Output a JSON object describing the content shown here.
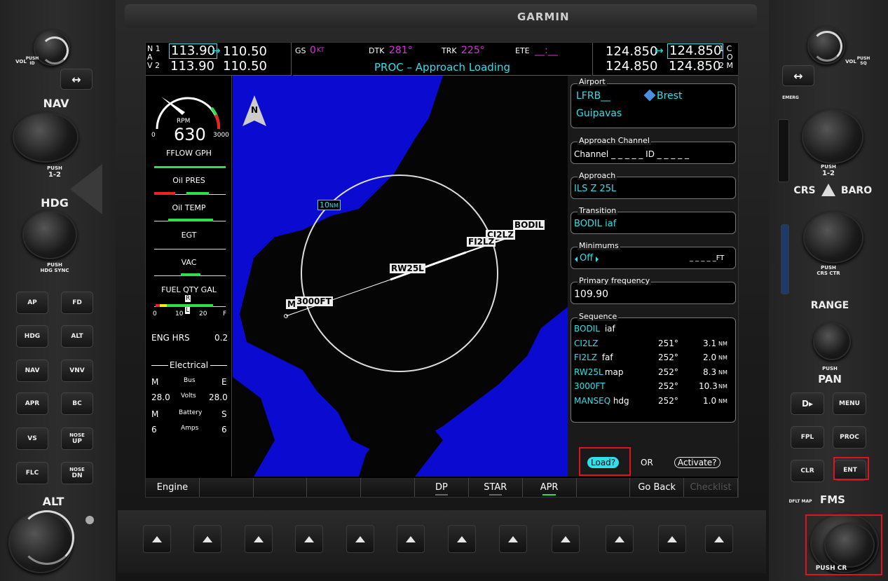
{
  "brand": "GARMIN",
  "left_panel": {
    "vol_label": "VOL",
    "vol_push": "PUSH ID",
    "swap_label": "↔",
    "nav_label": "NAV",
    "nav_push": "PUSH",
    "nav_push2": "1-2",
    "hdg_label": "HDG",
    "hdg_push": "PUSH",
    "hdg_push2": "HDG SYNC",
    "alt_label": "ALT",
    "buttons": {
      "ap": "AP",
      "fd": "FD",
      "hdg": "HDG",
      "alt": "ALT",
      "nav": "NAV",
      "vnv": "VNV",
      "apr": "APR",
      "bc": "BC",
      "vs": "VS",
      "nose_up_1": "NOSE",
      "nose_up_2": "UP",
      "flc": "FLC",
      "nose_dn_1": "NOSE",
      "nose_dn_2": "DN"
    }
  },
  "right_panel": {
    "vol_label": "VOL",
    "vol_push": "PUSH SQ",
    "swap_label": "↔",
    "emerg_label": "EMERG",
    "com_push": "PUSH",
    "com_push2": "1-2",
    "crs_label": "CRS",
    "baro_label": "BARO",
    "crs_push": "PUSH",
    "crs_push2": "CRS CTR",
    "range_label": "RANGE",
    "pan_push": "PUSH",
    "pan_label": "PAN",
    "buttons": {
      "direct": "D▸",
      "menu": "MENU",
      "fpl": "FPL",
      "proc": "PROC",
      "clr": "CLR",
      "ent": "ENT"
    },
    "dfltmap_label": "DFLT MAP",
    "fms_label": "FMS",
    "fms_push": "PUSH CR"
  },
  "nav_radio": {
    "nav1_label": "N 1",
    "nav2_label": "V 2",
    "nav_a": "A",
    "nav1_active": "113.90",
    "nav1_standby": "110.50",
    "nav2_active": "113.90",
    "nav2_standby": "110.50",
    "swap_arrow": "↔"
  },
  "com_radio": {
    "com1_active": "124.850",
    "com1_standby": "124.850",
    "com2_active": "124.850",
    "com2_standby": "124.850",
    "label_1": "1 C",
    "label_o": "O",
    "label_2": "2 M",
    "swap_arrow": "↔"
  },
  "status": {
    "gs_label": "GS",
    "gs_value": "0",
    "gs_unit": "KT",
    "dtk_label": "DTK",
    "dtk_value": "281°",
    "trk_label": "TRK",
    "trk_value": "225°",
    "ete_label": "ETE",
    "ete_value": "__:__",
    "message": "PROC – Approach Loading"
  },
  "eis": {
    "rpm_label": "RPM",
    "rpm_value": "630",
    "rpm_min": "0",
    "rpm_max": "3000",
    "fflow": "FFLOW GPH",
    "oil_pres": "Oil PRES",
    "oil_temp": "Oil TEMP",
    "egt": "EGT",
    "vac": "VAC",
    "fuel_qty": "FUEL QTY GAL",
    "fuel_r": "R",
    "fuel_l": "L",
    "fuel_ticks": [
      "0",
      "10",
      "20",
      "F"
    ],
    "eng_hrs_label": "ENG HRS",
    "eng_hrs_value": "0.2",
    "electrical": "Electrical",
    "m": "M",
    "bus": "Bus",
    "e": "E",
    "volts_m": "28.0",
    "volts": "Volts",
    "volts_e": "28.0",
    "m2": "M",
    "battery": "Battery",
    "s": "S",
    "amps_m": "6",
    "amps": "Amps",
    "amps_s": "6"
  },
  "map": {
    "north": "N",
    "range_ring": "10",
    "range_unit": "NM",
    "waypoints": [
      "BODIL",
      "CI2LZ",
      "FI2LZ",
      "RW25L",
      "3000FT",
      "M"
    ]
  },
  "proc": {
    "airport_title": "Airport",
    "airport_ident": "LFRB__",
    "airport_city": "Brest",
    "airport_name": "Guipavas",
    "channel_title": "Approach Channel",
    "channel_value": "Channel _ _ _ _ _ ID _ _ _ _ _",
    "approach_title": "Approach",
    "approach_value": "ILS Z 25L",
    "transition_title": "Transition",
    "transition_value": "BODIL iaf",
    "minimums_title": "Minimums",
    "minimums_value": "Off",
    "minimums_ft": "_ _ _ _ _FT",
    "freq_title": "Primary frequency",
    "freq_value": "109.90",
    "sequence_title": "Sequence",
    "sequence": [
      {
        "wpt": "BODIL",
        "suffix": " iaf",
        "crs": "",
        "dist": "",
        "unit": ""
      },
      {
        "wpt": "CI2LZ",
        "suffix": "",
        "crs": "251°",
        "dist": "3.1",
        "unit": "NM"
      },
      {
        "wpt": "FI2LZ",
        "suffix": " faf",
        "crs": "252°",
        "dist": "2.0",
        "unit": "NM"
      },
      {
        "wpt": "RW25L",
        "suffix": " map",
        "crs": "252°",
        "dist": "8.3",
        "unit": "NM"
      },
      {
        "wpt": "3000FT",
        "suffix": "",
        "crs": "252°",
        "dist": "10.3",
        "unit": "NM"
      },
      {
        "wpt": "MANSEQ",
        "suffix": " hdg",
        "crs": "252°",
        "dist": "1.0",
        "unit": "NM"
      }
    ],
    "load_label": "Load?",
    "or_label": "OR",
    "activate_label": "Activate?"
  },
  "softkeys": [
    "Engine",
    "",
    "",
    "",
    "",
    "DP",
    "STAR",
    "APR",
    "",
    "Go Back",
    "Checklist"
  ]
}
